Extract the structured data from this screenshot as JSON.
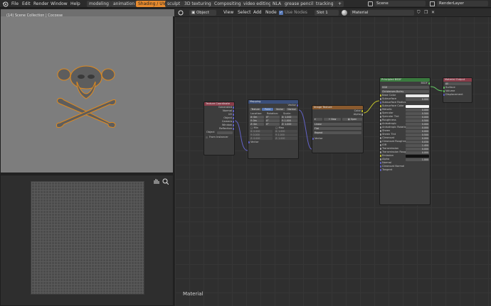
{
  "menu": [
    "File",
    "Edit",
    "Render",
    "Window",
    "Help"
  ],
  "workspaces": [
    {
      "label": "modeling",
      "active": false
    },
    {
      "label": "animation",
      "active": false
    },
    {
      "label": "Shading / UV",
      "active": true
    },
    {
      "label": "sculpt",
      "active": false
    },
    {
      "label": "3D texturing",
      "active": false
    },
    {
      "label": "Compositing",
      "active": false
    },
    {
      "label": "video editing",
      "active": false
    },
    {
      "label": "NLA",
      "active": false
    },
    {
      "label": "grease pencil",
      "active": false
    },
    {
      "label": "tracking",
      "active": false
    }
  ],
  "add_tab": "+",
  "scene": "Scene",
  "render_layer": "RenderLayer",
  "viewport": {
    "overlay_text": "(14) Scene Collection | Cocosse"
  },
  "image_editor": {
    "icons": [
      "hand-icon",
      "zoom-icon"
    ]
  },
  "node_header": {
    "mode": "Object",
    "menus": [
      "View",
      "Select",
      "Add",
      "Node"
    ],
    "use_nodes_label": "Use Nodes",
    "slot": "Slot 1",
    "material": "Material"
  },
  "node_editor_label": "Material",
  "nodes": {
    "texcoord": {
      "title": "Texture Coordinate",
      "outputs": [
        "Generated",
        "Normal",
        "UV",
        "Object",
        "Camera",
        "Window",
        "Reflection"
      ],
      "object_label": "Object",
      "from_instancer": "From Instancer"
    },
    "mapping": {
      "title": "Mapping",
      "vector_out": "Vector",
      "tabs": [
        "Texture",
        "Point",
        "Vector",
        "Normal"
      ],
      "col_headers": [
        "Location:",
        "Rotation:",
        "Scale:"
      ],
      "rows": [
        [
          "X:",
          "0m",
          "0°",
          "X: 1.000"
        ],
        [
          "Y:",
          "0m",
          "0°",
          "Y: 1.000"
        ],
        [
          "Z:",
          "0m",
          "0°",
          "Z: 1.000"
        ]
      ],
      "min_label": "Min",
      "max_label": "Max",
      "minmax_rows": [
        [
          "X: 0.000",
          "X: 1.000"
        ],
        [
          "Y: 0.000",
          "Y: 1.000"
        ],
        [
          "Z: 0.000",
          "Z: 1.000"
        ]
      ],
      "vector_in": "Vector"
    },
    "image": {
      "title": "Image Texture",
      "outputs": [
        "Color",
        "Alpha"
      ],
      "buttons": [
        "New",
        "Open"
      ],
      "interp": "Linear",
      "proj": "Flat",
      "ext": "Repeat",
      "vector_in": "Vector"
    },
    "bsdf": {
      "title": "Principled BSDF",
      "bsdf_out": "BSDF",
      "distribution": "GGX",
      "subsurface_method": "Christensen-Burley",
      "rows": [
        {
          "label": "Base Color",
          "value": ""
        },
        {
          "label": "Subsurface",
          "value": "0.000"
        },
        {
          "label": "Subsurface Radius",
          "value": ""
        },
        {
          "label": "Subsurface Color",
          "value": ""
        },
        {
          "label": "Metallic",
          "value": "0.000"
        },
        {
          "label": "Specular",
          "value": "0.500"
        },
        {
          "label": "Specular Tint",
          "value": "0.000"
        },
        {
          "label": "Roughness",
          "value": "0.500"
        },
        {
          "label": "Anisotropic",
          "value": "0.000"
        },
        {
          "label": "Anisotropic Rotation",
          "value": "0.000"
        },
        {
          "label": "Sheen",
          "value": "0.000"
        },
        {
          "label": "Sheen Tint",
          "value": "0.500"
        },
        {
          "label": "Clearcoat",
          "value": "0.000"
        },
        {
          "label": "Clearcoat Roughness",
          "value": "0.030"
        },
        {
          "label": "IOR",
          "value": "1.450"
        },
        {
          "label": "Transmission",
          "value": "0.000"
        },
        {
          "label": "Transmission Roughness",
          "value": "0.000"
        },
        {
          "label": "Emission",
          "value": ""
        },
        {
          "label": "Alpha",
          "value": "1.000"
        },
        {
          "label": "Normal",
          "value": ""
        },
        {
          "label": "Clearcoat Normal",
          "value": ""
        },
        {
          "label": "Tangent",
          "value": ""
        }
      ]
    },
    "output": {
      "title": "Material Output",
      "target": "All",
      "inputs": [
        "Surface",
        "Volume",
        "Displacement"
      ]
    }
  },
  "colors": {
    "accent": "#e68a2e",
    "shader_socket": "#63c763",
    "color_socket": "#c7c729",
    "vector_socket": "#6363c7"
  }
}
